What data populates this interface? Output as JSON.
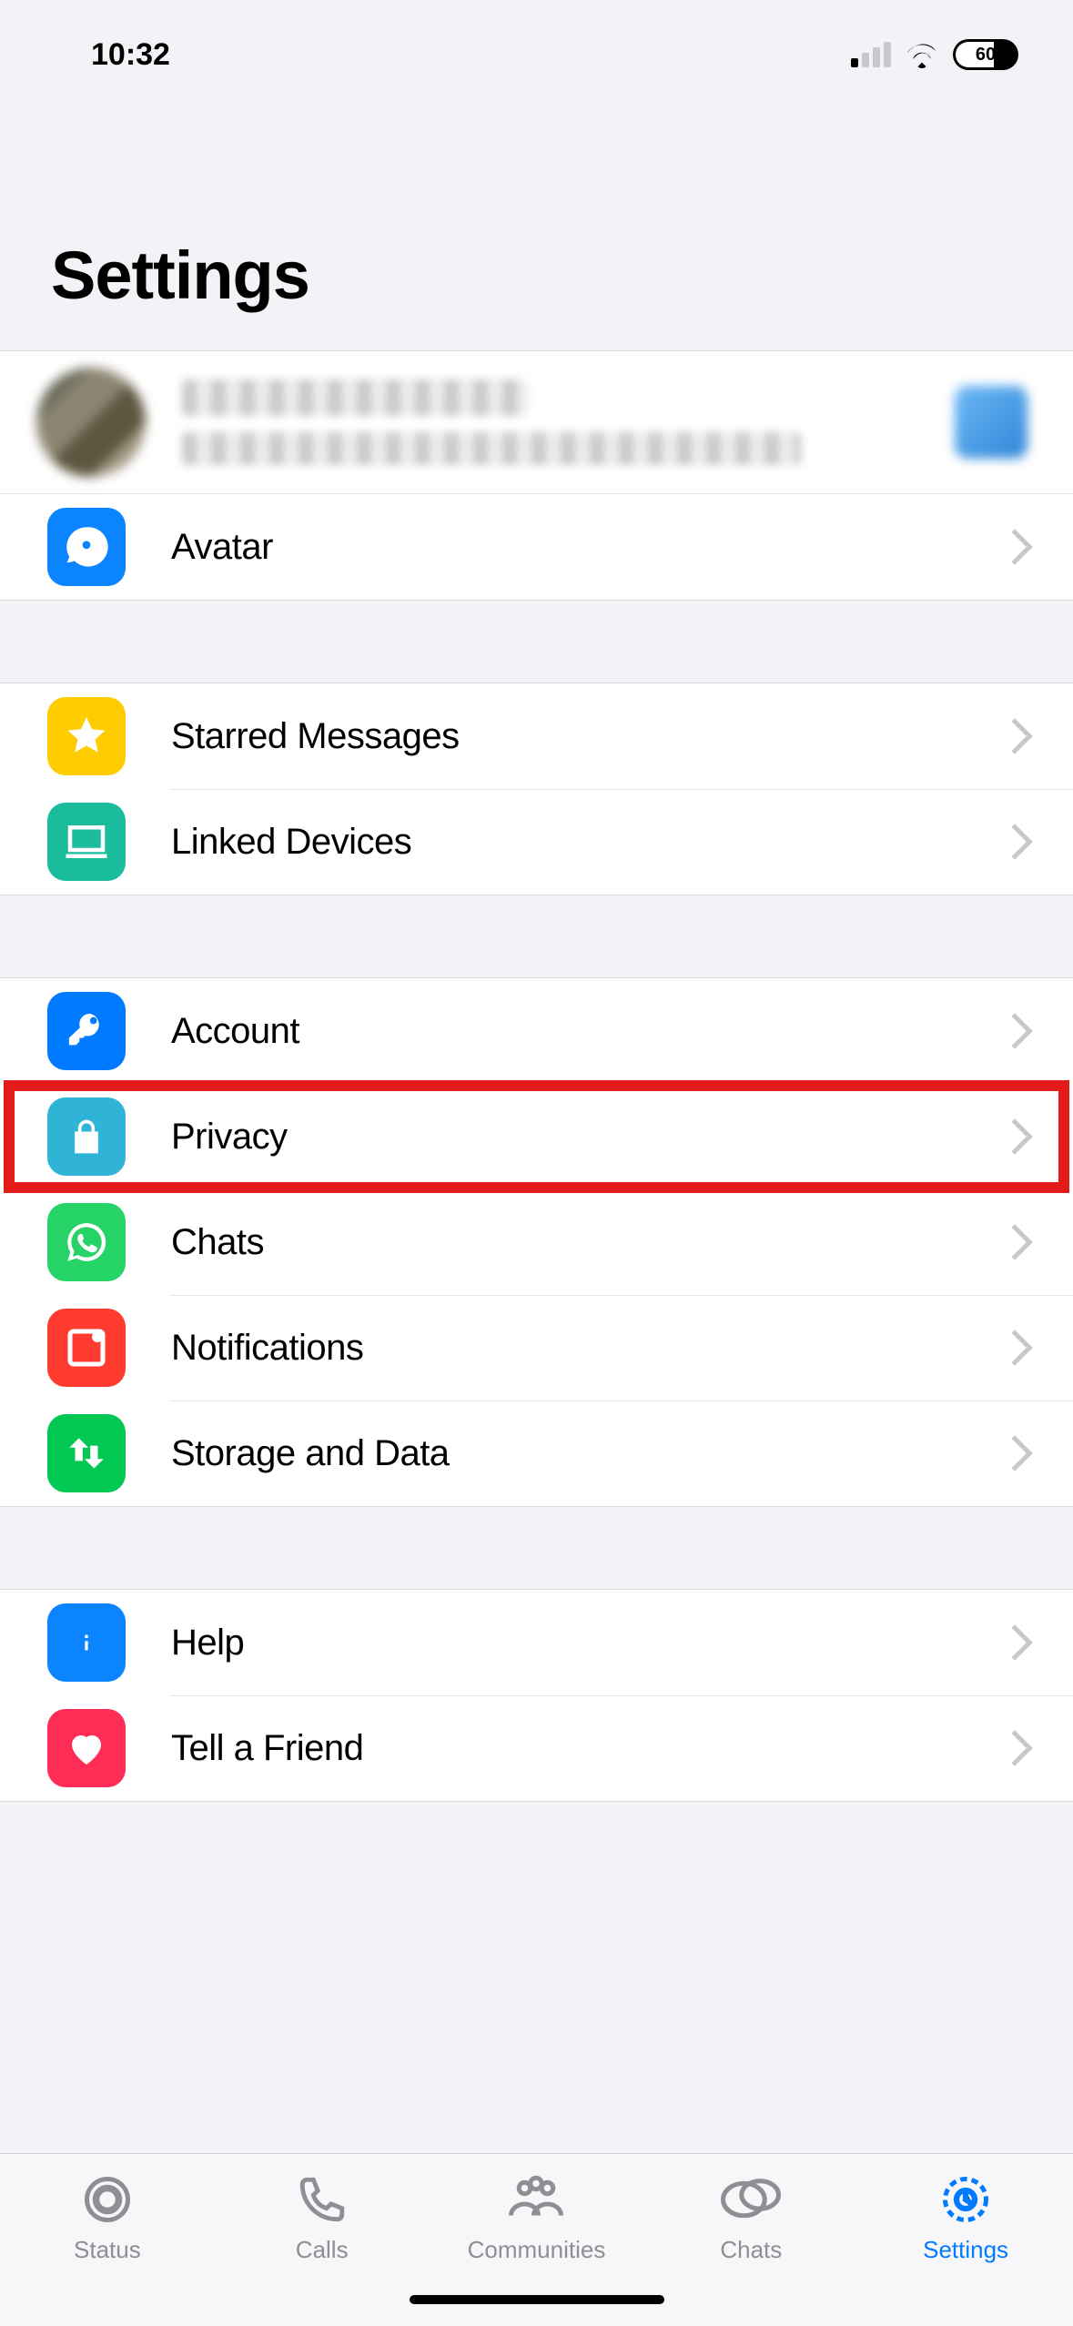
{
  "statusBar": {
    "time": "10:32",
    "battery": "60"
  },
  "header": {
    "title": "Settings"
  },
  "rows": {
    "avatar": "Avatar",
    "starred": "Starred Messages",
    "linked": "Linked Devices",
    "account": "Account",
    "privacy": "Privacy",
    "chats": "Chats",
    "notifications": "Notifications",
    "storage": "Storage and Data",
    "help": "Help",
    "tell": "Tell a Friend"
  },
  "tabs": {
    "status": "Status",
    "calls": "Calls",
    "communities": "Communities",
    "chats": "Chats",
    "settings": "Settings"
  },
  "highlighted_row": "privacy"
}
